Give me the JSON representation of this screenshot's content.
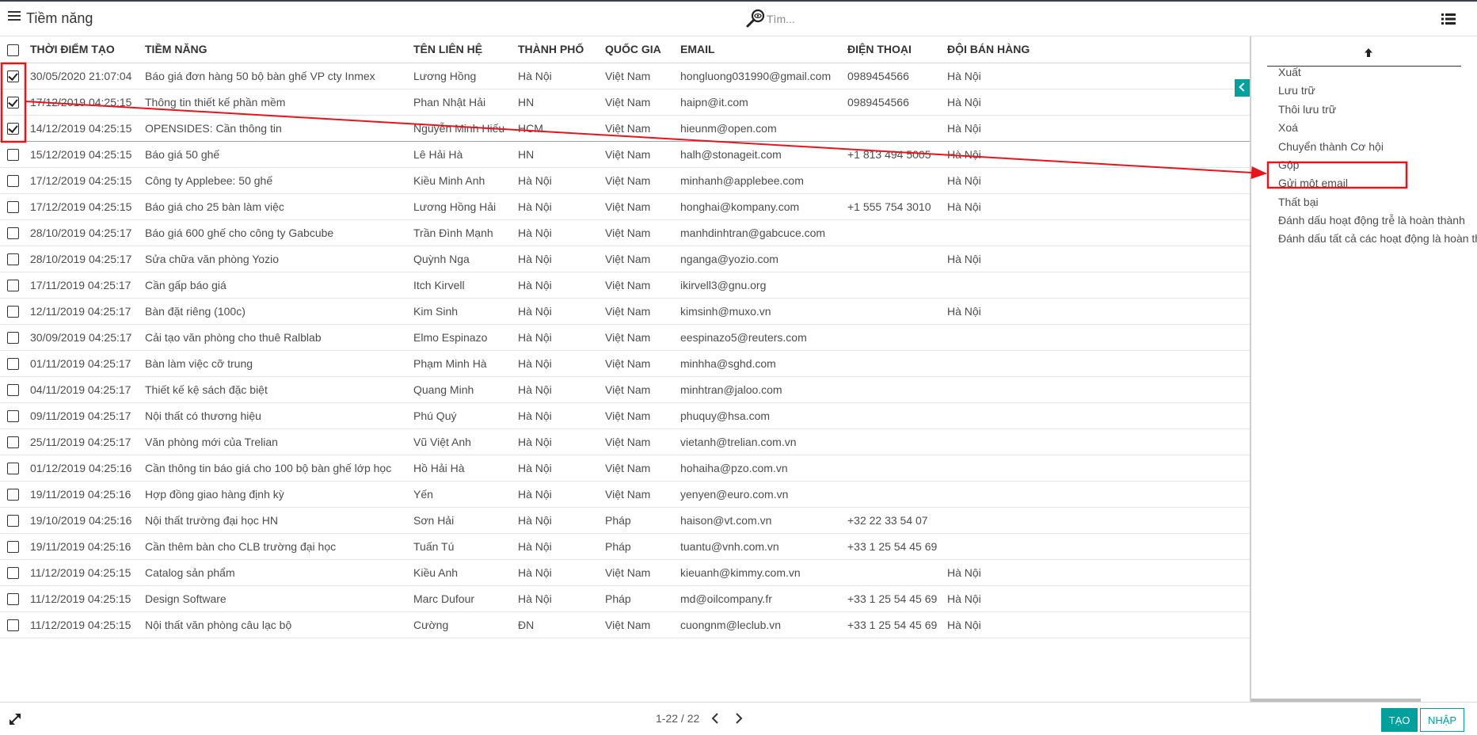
{
  "app": {
    "title": "Tiềm năng"
  },
  "search": {
    "placeholder": "Tìm..."
  },
  "table": {
    "columns": [
      "THỜI ĐIỂM TẠO",
      "TIỀM NĂNG",
      "TÊN LIÊN HỆ",
      "THÀNH PHỐ",
      "QUỐC GIA",
      "EMAIL",
      "ĐIỆN THOẠI",
      "ĐỘI BÁN HÀNG"
    ],
    "rows": [
      {
        "checked": true,
        "cells": [
          "30/05/2020 21:07:04",
          "Báo giá đơn hàng 50 bộ bàn ghế VP cty Inmex",
          "Lương Hồng",
          "Hà Nội",
          "Việt Nam",
          "hongluong031990@gmail.com",
          "0989454566",
          "Hà Nội"
        ]
      },
      {
        "checked": true,
        "cells": [
          "17/12/2019 04:25:15",
          "Thông tin thiết kế phần mềm",
          "Phan Nhật Hải",
          "HN",
          "Việt Nam",
          "haipn@it.com",
          "0989454566",
          "Hà Nội"
        ]
      },
      {
        "checked": true,
        "cells": [
          "14/12/2019 04:25:15",
          "OPENSIDES: Cần thông tin",
          "Nguyễn Minh Hiếu",
          "HCM",
          "Việt Nam",
          "hieunm@open.com",
          "",
          "Hà Nội"
        ]
      },
      {
        "checked": false,
        "cells": [
          "15/12/2019 04:25:15",
          "Báo giá 50 ghế",
          "Lê Hải Hà",
          "HN",
          "Việt Nam",
          "halh@stonageit.com",
          "+1 813 494 5005",
          "Hà Nội"
        ]
      },
      {
        "checked": false,
        "cells": [
          "17/12/2019 04:25:15",
          "Công ty Applebee: 50 ghế",
          "Kiều Minh Anh",
          "Hà Nội",
          "Việt Nam",
          "minhanh@applebee.com",
          "",
          "Hà Nội"
        ]
      },
      {
        "checked": false,
        "cells": [
          "17/12/2019 04:25:15",
          "Báo giá cho 25 bàn làm việc",
          "Lương Hồng Hải",
          "Hà Nội",
          "Việt Nam",
          "honghai@kompany.com",
          "+1 555 754 3010",
          "Hà Nội"
        ]
      },
      {
        "checked": false,
        "cells": [
          "28/10/2019 04:25:17",
          "Báo giá 600 ghế cho công ty Gabcube",
          "Trần Đình Mạnh",
          "Hà Nội",
          "Việt Nam",
          "manhdinhtran@gabcuce.com",
          "",
          ""
        ]
      },
      {
        "checked": false,
        "cells": [
          "28/10/2019 04:25:17",
          "Sửa chữa văn phòng Yozio",
          "Quỳnh Nga",
          "Hà Nội",
          "Việt Nam",
          "nganga@yozio.com",
          "",
          "Hà Nội"
        ]
      },
      {
        "checked": false,
        "cells": [
          "17/11/2019 04:25:17",
          "Cần gấp báo giá",
          "Itch Kirvell",
          "Hà Nội",
          "Việt Nam",
          "ikirvell3@gnu.org",
          "",
          ""
        ]
      },
      {
        "checked": false,
        "cells": [
          "12/11/2019 04:25:17",
          "Bàn đặt riêng (100c)",
          "Kim Sinh",
          "Hà Nội",
          "Việt Nam",
          "kimsinh@muxo.vn",
          "",
          "Hà Nội"
        ]
      },
      {
        "checked": false,
        "cells": [
          "30/09/2019 04:25:17",
          "Cải tạo văn phòng cho thuê Ralblab",
          "Elmo Espinazo",
          "Hà Nội",
          "Việt Nam",
          "eespinazo5@reuters.com",
          "",
          ""
        ]
      },
      {
        "checked": false,
        "cells": [
          "01/11/2019 04:25:17",
          "Bàn làm việc cỡ trung",
          "Phạm Minh Hà",
          "Hà Nội",
          "Việt Nam",
          "minhha@sghd.com",
          "",
          ""
        ]
      },
      {
        "checked": false,
        "cells": [
          "04/11/2019 04:25:17",
          "Thiết kế kệ sách đặc biệt",
          "Quang Minh",
          "Hà Nội",
          "Việt Nam",
          "minhtran@jaloo.com",
          "",
          ""
        ]
      },
      {
        "checked": false,
        "cells": [
          "09/11/2019 04:25:17",
          "Nội thất có thương hiệu",
          "Phú Quý",
          "Hà Nội",
          "Việt Nam",
          "phuquy@hsa.com",
          "",
          ""
        ]
      },
      {
        "checked": false,
        "cells": [
          "25/11/2019 04:25:17",
          "Văn phòng mới của Trelian",
          "Vũ Việt Anh",
          "Hà Nội",
          "Việt Nam",
          "vietanh@trelian.com.vn",
          "",
          ""
        ]
      },
      {
        "checked": false,
        "cells": [
          "01/12/2019 04:25:16",
          "Cần thông tin báo giá cho 100 bộ bàn ghế lớp học",
          "Hồ Hải Hà",
          "Hà Nội",
          "Việt Nam",
          "hohaiha@pzo.com.vn",
          "",
          ""
        ]
      },
      {
        "checked": false,
        "cells": [
          "19/11/2019 04:25:16",
          "Hợp đồng giao hàng định kỳ",
          "Yến",
          "Hà Nội",
          "Việt Nam",
          "yenyen@euro.com.vn",
          "",
          ""
        ]
      },
      {
        "checked": false,
        "cells": [
          "19/10/2019 04:25:16",
          "Nội thất trường đại học HN",
          "Sơn Hải",
          "Hà Nội",
          "Pháp",
          "haison@vt.com.vn",
          "+32 22 33 54 07",
          ""
        ]
      },
      {
        "checked": false,
        "cells": [
          "19/11/2019 04:25:16",
          "Cần thêm bàn cho CLB trường đại học",
          "Tuấn Tú",
          "Hà Nội",
          "Pháp",
          "tuantu@vnh.com.vn",
          "+33 1 25 54 45 69",
          ""
        ]
      },
      {
        "checked": false,
        "cells": [
          "11/12/2019 04:25:15",
          "Catalog sản phẩm",
          "Kiều Anh",
          "Hà Nội",
          "Việt Nam",
          "kieuanh@kimmy.com.vn",
          "",
          "Hà Nội"
        ]
      },
      {
        "checked": false,
        "cells": [
          "11/12/2019 04:25:15",
          "Design Software",
          "Marc Dufour",
          "Hà Nội",
          "Pháp",
          "md@oilcompany.fr",
          "+33 1 25 54 45 69",
          "Hà Nội"
        ]
      },
      {
        "checked": false,
        "cells": [
          "11/12/2019 04:25:15",
          "Nội thất văn phòng câu lạc bộ",
          "Cường",
          "ĐN",
          "Việt Nam",
          "cuongnm@leclub.vn",
          "+33 1 25 54 45 69",
          "Hà Nội"
        ]
      }
    ]
  },
  "action_menu": {
    "items": [
      "Xuất",
      "Lưu trữ",
      "Thôi lưu trữ",
      "Xoá",
      "Chuyển thành Cơ hội",
      "Gộp",
      "Gửi một email",
      "Thất bại",
      "Đánh dấu hoạt động trễ là hoàn thành",
      "Đánh dấu tất cả các hoạt động là hoàn thành"
    ]
  },
  "pager": {
    "text": "1-22 / 22"
  },
  "buttons": {
    "create": "TẠO",
    "import": "NHẬP"
  },
  "colors": {
    "accent": "#00a09d",
    "annotation": "#e8141b"
  },
  "icons": [
    "menu-icon",
    "search-icon",
    "list-view-icon",
    "arrow-up-icon",
    "chevron-left-icon",
    "expand-icon",
    "chevron-left-icon",
    "chevron-right-icon"
  ]
}
